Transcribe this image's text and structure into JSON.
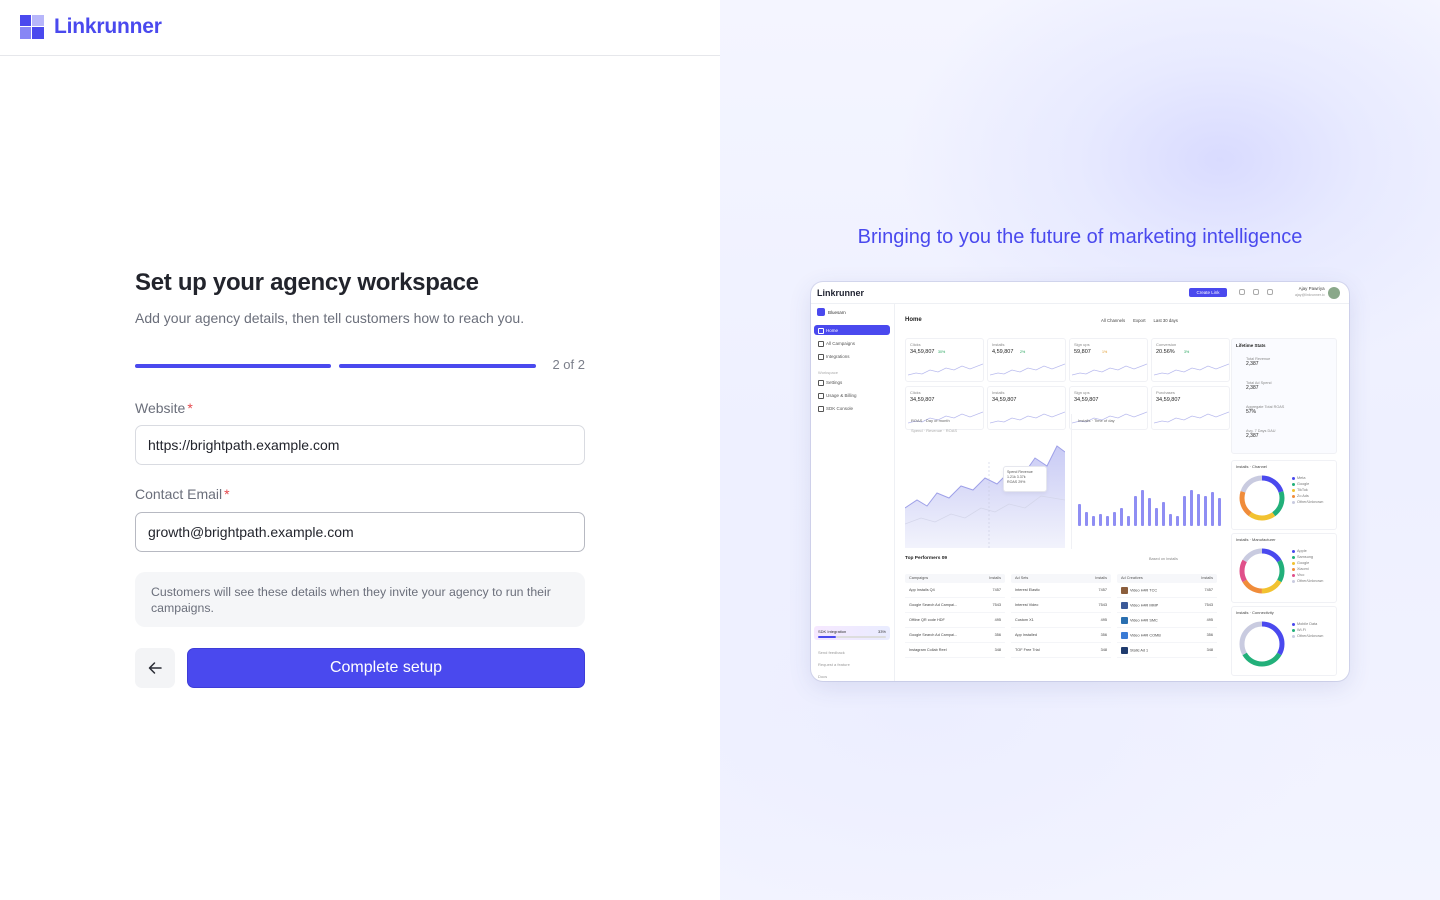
{
  "brand": {
    "name": "Linkrunner",
    "color": "#4a49ee"
  },
  "form": {
    "title": "Set up your agency workspace",
    "subtitle": "Add your agency details, then tell customers how to reach you.",
    "progress": {
      "current": 2,
      "total": 2,
      "label": "2 of 2"
    },
    "website": {
      "label": "Website",
      "required_mark": "*",
      "value": "https://brightpath.example.com"
    },
    "email": {
      "label": "Contact Email",
      "required_mark": "*",
      "value": "growth@brightpath.example.com"
    },
    "note": "Customers will see these details when they invite your agency to run their campaigns.",
    "back_icon": "arrow-left-icon",
    "submit_label": "Complete setup"
  },
  "promo": {
    "tagline": "Bringing to you the future of marketing intelligence",
    "preview": {
      "logo": "Linkrunner",
      "create_link": "Create Link",
      "user_name": "Ajay Pawriya",
      "user_email": "ajay@linkrunner.io",
      "workspace": "Bluesarn",
      "nav": [
        "Home",
        "All Campaigns",
        "Integrations"
      ],
      "section": "Workspace",
      "nav2": [
        "Settings",
        "Usage & Billing",
        "SDK Console"
      ],
      "sdk": {
        "label": "SDK Integration",
        "percent": "33%"
      },
      "footer": [
        "Send feedback",
        "Request a feature",
        "Docs"
      ],
      "page_title": "Home",
      "filters": [
        "All Channels",
        "Export",
        "Last 30 days"
      ],
      "kpis": [
        {
          "label": "Clicks",
          "value": "34,59,807",
          "delta": "30%"
        },
        {
          "label": "Installs",
          "value": "4,59,807",
          "delta": "2%"
        },
        {
          "label": "Sign ups",
          "value": "59,807",
          "delta": "1%"
        },
        {
          "label": "Conversion",
          "value": "20.56%",
          "delta": "3%"
        },
        {
          "label": "Clicks",
          "value": "34,59,807",
          "delta": ""
        },
        {
          "label": "Installs",
          "value": "34,59,807",
          "delta": ""
        },
        {
          "label": "Sign ups",
          "value": "34,59,807",
          "delta": ""
        },
        {
          "label": "Purchases",
          "value": "34,59,807",
          "delta": ""
        }
      ],
      "lifetime": {
        "title": "Lifetime Stats",
        "rows": [
          {
            "label": "Total Revenue",
            "value": "2,387"
          },
          {
            "label": "Total Ad Spend",
            "value": "2,387"
          },
          {
            "label": "Aggregate Total ROAS",
            "value": "57%"
          },
          {
            "label": "Avg. 7 Days DAU",
            "value": "2,387"
          }
        ]
      },
      "roas": {
        "title": "ROAS",
        "by": "Day of month",
        "legend": [
          "Spend",
          "Revenue",
          "ROAS"
        ],
        "tip": [
          "Spend",
          "Revenue",
          "1.21k",
          "3.37k",
          "ROAS",
          "29%"
        ]
      },
      "installs_chart": {
        "title": "Installs",
        "by": "Time of day"
      },
      "donuts": [
        {
          "title": "Installs",
          "by": "Channel",
          "legend": [
            "Meta",
            "Google",
            "TikTok",
            "Zo Ads",
            "Other/Unknown"
          ]
        },
        {
          "title": "Installs",
          "by": "Manufacturer",
          "legend": [
            "Apple",
            "Samsung",
            "Google",
            "Xiaomi",
            "Vivo",
            "Other/Unknown"
          ]
        },
        {
          "title": "Installs",
          "by": "Connectivity",
          "legend": [
            "Mobile Data",
            "Wi-Fi",
            "Other/Unknown"
          ]
        }
      ],
      "top_performers": {
        "title": "Top Performers",
        "badge": "09",
        "based_on": "Based on",
        "metric": "Installs",
        "tables": [
          {
            "head": "Campaigns",
            "col": "Installs",
            "rows": [
              [
                "App Installs Q4",
                "7457"
              ],
              [
                "Google Search Ad Campai...",
                "7543"
              ],
              [
                "Offline QR code HDF",
                "495"
              ],
              [
                "Google Search Ad Campai...",
                "356"
              ],
              [
                "Instagram Collab Reel",
                "348"
              ]
            ]
          },
          {
            "head": "Ad Sets",
            "col": "Installs",
            "rows": [
              [
                "Interest Elastic",
                "7457"
              ],
              [
                "Interest Video",
                "7543"
              ],
              [
                "Custom X1",
                "495"
              ],
              [
                "App Installed",
                "356"
              ],
              [
                "TOF Free Trial",
                "348"
              ]
            ]
          },
          {
            "head": "Ad Creatives",
            "col": "Installs",
            "rows": [
              [
                "Video H4R TCC",
                "7457"
              ],
              [
                "Video H4R MMP",
                "7543"
              ],
              [
                "Video H4R SMC",
                "495"
              ],
              [
                "Video H4R COMB",
                "356"
              ],
              [
                "Static Ad 1",
                "348"
              ]
            ]
          }
        ]
      }
    }
  }
}
